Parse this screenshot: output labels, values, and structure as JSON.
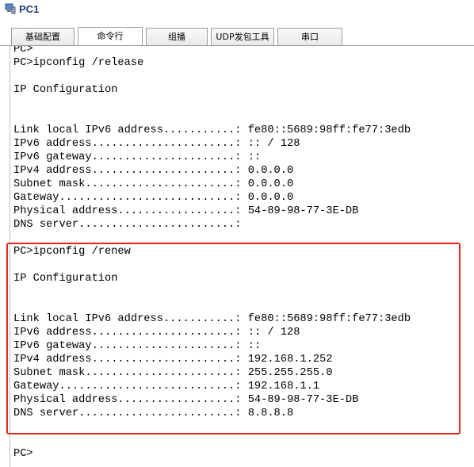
{
  "window": {
    "title": "PC1",
    "icon": "pc-app-icon"
  },
  "tabs": [
    {
      "label": "基础配置",
      "active": false
    },
    {
      "label": "命令行",
      "active": true
    },
    {
      "label": "组播",
      "active": false
    },
    {
      "label": "UDP发包工具",
      "active": false
    },
    {
      "label": "串口",
      "active": false
    }
  ],
  "console": {
    "lines": [
      "PC>",
      "PC>ipconfig /release",
      "",
      "IP Configuration",
      "",
      "",
      "Link local IPv6 address...........: fe80::5689:98ff:fe77:3edb",
      "IPv6 address......................: :: / 128",
      "IPv6 gateway......................: ::",
      "IPv4 address......................: 0.0.0.0",
      "Subnet mask.......................: 0.0.0.0",
      "Gateway...........................: 0.0.0.0",
      "Physical address..................: 54-89-98-77-3E-DB",
      "DNS server........................:",
      "",
      "PC>ipconfig /renew",
      "",
      "IP Configuration",
      "",
      "",
      "Link local IPv6 address...........: fe80::5689:98ff:fe77:3edb",
      "IPv6 address......................: :: / 128",
      "IPv6 gateway......................: ::",
      "IPv4 address......................: 192.168.1.252",
      "Subnet mask.......................: 255.255.255.0",
      "Gateway...........................: 192.168.1.1",
      "Physical address..................: 54-89-98-77-3E-DB",
      "DNS server........................: 8.8.8.8",
      "",
      "",
      "PC>"
    ]
  },
  "colors": {
    "highlight": "#e8241f",
    "title_text": "#1f3f7a"
  }
}
